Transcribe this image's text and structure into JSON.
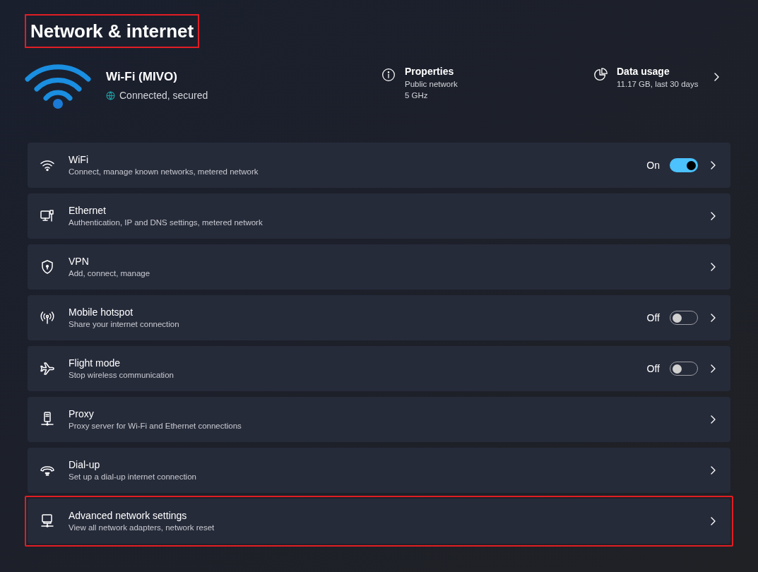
{
  "title": {
    "text": "Network & internet",
    "highlighted": true
  },
  "connection": {
    "name": "Wi-Fi (MIVO)",
    "status": "Connected, secured"
  },
  "properties": {
    "title": "Properties",
    "lines": [
      "Public network",
      "5 GHz"
    ]
  },
  "data_usage": {
    "title": "Data usage",
    "detail": "11.17 GB, last 30 days"
  },
  "rows": [
    {
      "kind": "toggle",
      "title": "WiFi",
      "subtitle": "Connect, manage known networks, metered network",
      "state_label": "On",
      "on": true,
      "highlighted": false
    },
    {
      "kind": "link",
      "title": "Ethernet",
      "subtitle": "Authentication, IP and DNS settings, metered network",
      "highlighted": false
    },
    {
      "kind": "link",
      "title": "VPN",
      "subtitle": "Add, connect, manage",
      "highlighted": false
    },
    {
      "kind": "toggle",
      "title": "Mobile hotspot",
      "subtitle": "Share your internet connection",
      "state_label": "Off",
      "on": false,
      "highlighted": false
    },
    {
      "kind": "toggle",
      "title": "Flight mode",
      "subtitle": "Stop wireless communication",
      "state_label": "Off",
      "on": false,
      "highlighted": false
    },
    {
      "kind": "link",
      "title": "Proxy",
      "subtitle": "Proxy server for Wi-Fi and Ethernet connections",
      "highlighted": false
    },
    {
      "kind": "link",
      "title": "Dial-up",
      "subtitle": "Set up a dial-up internet connection",
      "highlighted": false
    },
    {
      "kind": "link",
      "title": "Advanced network settings",
      "subtitle": "View all network adapters, network reset",
      "highlighted": true
    }
  ]
}
